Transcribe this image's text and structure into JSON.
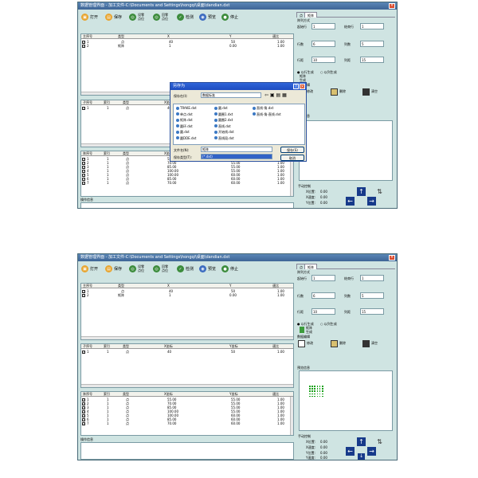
{
  "title": "数据管理界面 - 加工文件-C:\\Documents and Settings\\hongqi\\桌面\\dandian.dxt",
  "toolbar": [
    {
      "name": "open",
      "label": "打开",
      "icon": "folder-icon",
      "color": "#e8a530"
    },
    {
      "name": "save",
      "label": "保存",
      "icon": "disk-icon",
      "color": "#e8a530"
    },
    {
      "name": "set-origin",
      "label": "设零\n点位",
      "icon": "target-icon",
      "color": "#3c8c3c"
    },
    {
      "name": "goto-origin",
      "label": "回零\n点位",
      "icon": "target-icon",
      "color": "#3c8c3c"
    },
    {
      "name": "test",
      "label": "检测",
      "icon": "check-icon",
      "color": "#3c8c3c"
    },
    {
      "name": "preview",
      "label": "预览",
      "icon": "eye-icon",
      "color": "#3c6cc0"
    },
    {
      "name": "stop",
      "label": "停止",
      "icon": "stop-icon",
      "color": "#3c8c3c"
    }
  ],
  "main_table": {
    "headers": [
      "主序号",
      "类型",
      "X",
      "Y",
      "速比"
    ],
    "rows": [
      {
        "no": "1",
        "type": "点",
        "x": "40",
        "y": "50",
        "ratio": "1.00"
      },
      {
        "no": "2",
        "type": "矩阵",
        "x": "1",
        "y": "0.00",
        "ratio": "1.00"
      }
    ]
  },
  "sub_table": {
    "headers": [
      "子序号",
      "索引",
      "类型",
      "X坐标",
      "Y坐标",
      "速比"
    ],
    "rows": [
      {
        "no": "1",
        "idx": "1",
        "type": "点",
        "x": "40",
        "y": "50",
        "ratio": "1.00"
      }
    ]
  },
  "detail_table": {
    "headers": [
      "阵序号",
      "索引",
      "类型",
      "X坐标",
      "Y坐标",
      "速比"
    ],
    "rows": [
      {
        "no": "1",
        "idx": "1",
        "type": "点",
        "x": "55.00",
        "y": "55.00",
        "ratio": "1.00"
      },
      {
        "no": "2",
        "idx": "1",
        "type": "点",
        "x": "70.00",
        "y": "55.00",
        "ratio": "1.00"
      },
      {
        "no": "3",
        "idx": "1",
        "type": "点",
        "x": "85.00",
        "y": "55.00",
        "ratio": "1.00"
      },
      {
        "no": "4",
        "idx": "1",
        "type": "点",
        "x": "100.00",
        "y": "55.00",
        "ratio": "1.00"
      },
      {
        "no": "5",
        "idx": "1",
        "type": "点",
        "x": "100.00",
        "y": "60.00",
        "ratio": "1.00"
      },
      {
        "no": "6",
        "idx": "1",
        "type": "点",
        "x": "85.00",
        "y": "60.00",
        "ratio": "1.00"
      },
      {
        "no": "7",
        "idx": "1",
        "type": "点",
        "x": "70.00",
        "y": "60.00",
        "ratio": "1.00"
      }
    ]
  },
  "ops_label": "操作信息",
  "right_panel": {
    "tabs": [
      "点",
      "矩阵"
    ],
    "array_label": "阵列方式",
    "start_row_label": "起始行",
    "start_row": "1",
    "end_row_label": "结束行",
    "end_row": "1",
    "rows_label": "行数",
    "rows": "6",
    "cols_label": "列数",
    "cols": "5",
    "row_gap_label": "行距",
    "row_gap": "10",
    "col_gap_label": "列距",
    "col_gap": "15",
    "gen_row_label": "以行生成",
    "gen_col_label": "以列生成",
    "gen_label": "矩阵\n生成",
    "edit_label": "数据编辑",
    "edit_modify": "修改",
    "edit_delete": "删除",
    "edit_clear": "清空",
    "preview_label": "预览信息"
  },
  "manual": {
    "label": "手动控制",
    "x_label": "X位置:",
    "x_val": "0.00",
    "xs_label": "X速度:",
    "xs_val": "0.00",
    "y_label": "Y位置:",
    "y_val": "0.00",
    "ys_label": "Y速度:",
    "ys_val": "0.00"
  },
  "dialog": {
    "title": "另存为",
    "save_in_label": "保存在(I):",
    "save_in_value": "数据标准",
    "files": [
      "TRAKE.dxt",
      "单点.dxt",
      "矩阵.dxt",
      "圆环.dxt",
      "圆.dxt",
      "圆DDE.dxt",
      "圆.dxt",
      "圆圈1.dxt",
      "圆圈2.dxt",
      "直线.dxt",
      "开始线.dxt",
      "直线段.dxt",
      "直线-角.dxt",
      "直线-角-直线.dxt"
    ],
    "filename_label": "文件名(N):",
    "filename_value": "矩阵",
    "filetype_label": "保存类型(T):",
    "filetype_value": "(*.dxt)",
    "save_btn": "保存(S)",
    "cancel_btn": "取消"
  }
}
